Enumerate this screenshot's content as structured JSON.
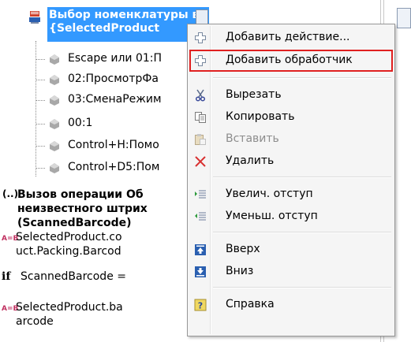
{
  "tree": {
    "header": {
      "line1": "Выбор номенклатуры в",
      "line2": "{SelectedProduct"
    },
    "children": [
      {
        "label": "Escape или 01:П"
      },
      {
        "label": "02:ПросмотрФа"
      },
      {
        "label": "03:СменаРежим"
      },
      {
        "label": "00:1"
      },
      {
        "label": "Control+H:Помо"
      },
      {
        "label": "Control+D5:Пом"
      }
    ],
    "operation": {
      "icon": "(..)",
      "line1": "Вызов операции Об",
      "line2": "неизвестного штрих",
      "line3": "(ScannedBarcode)"
    },
    "steps": [
      {
        "icon": "A=B",
        "line1": "SelectedProduct.co",
        "line2": "uct.Packing.Barcod"
      },
      {
        "icon": "if",
        "line1": "ScannedBarcode ="
      },
      {
        "icon": "A=B",
        "line1": "SelectedProduct.ba",
        "line2": "arcode"
      }
    ]
  },
  "context_menu": {
    "items": [
      {
        "label": "Добавить действие...",
        "icon": "plus-outline-icon",
        "disabled": false,
        "highlighted": false
      },
      {
        "label": "Добавить обработчик",
        "icon": "plus-outline-icon",
        "disabled": false,
        "highlighted": true
      },
      {
        "label": "Вырезать",
        "icon": "scissors-icon",
        "disabled": false,
        "highlighted": false
      },
      {
        "label": "Копировать",
        "icon": "copy-icon",
        "disabled": false,
        "highlighted": false
      },
      {
        "label": "Вставить",
        "icon": "paste-icon",
        "disabled": true,
        "highlighted": false
      },
      {
        "label": "Удалить",
        "icon": "delete-x-icon",
        "disabled": false,
        "highlighted": false
      },
      {
        "label": "Увелич. отступ",
        "icon": "indent-icon",
        "disabled": false,
        "highlighted": false
      },
      {
        "label": "Уменьш. отступ",
        "icon": "outdent-icon",
        "disabled": false,
        "highlighted": false
      },
      {
        "label": "Вверх",
        "icon": "move-up-icon",
        "disabled": false,
        "highlighted": false
      },
      {
        "label": "Вниз",
        "icon": "move-down-icon",
        "disabled": false,
        "highlighted": false
      },
      {
        "label": "Справка",
        "icon": "help-icon",
        "disabled": false,
        "highlighted": false
      }
    ]
  },
  "colors": {
    "selection": "#3399ff",
    "highlight_outline": "#e02020",
    "menu_background": "#f5f5f5",
    "disabled_text": "#8d8d8d"
  }
}
